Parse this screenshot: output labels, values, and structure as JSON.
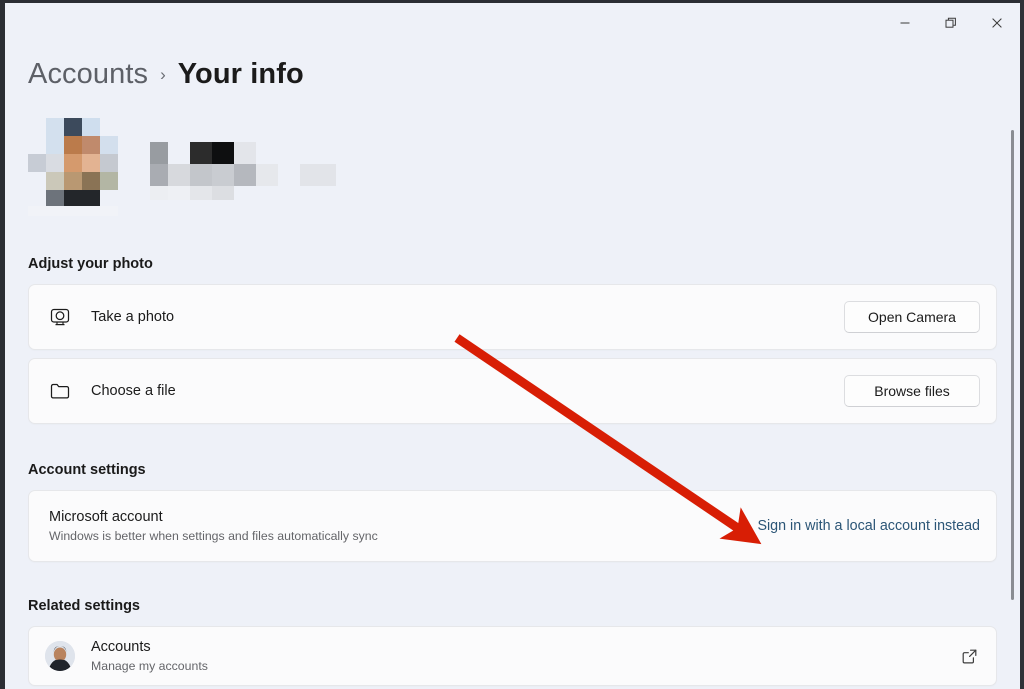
{
  "window": {
    "background_color": "#eef1f8",
    "card_color": "#fbfbfc",
    "accent_link_color": "#2b5576",
    "annotation_color": "#d81e05",
    "controls": {
      "minimize": "─",
      "restore": "❐",
      "close": "✕"
    }
  },
  "header": {
    "breadcrumb_root": "Accounts",
    "breadcrumb_separator": "›",
    "breadcrumb_current": "Your info"
  },
  "profile": {
    "redacted": true,
    "photo_note": "pixelated profile picture",
    "name_note": "pixelated account name",
    "email_note": "pixelated account email"
  },
  "sections": {
    "adjust_photo": {
      "title": "Adjust your photo",
      "rows": [
        {
          "icon": "camera-icon",
          "label": "Take a photo",
          "button": "Open Camera"
        },
        {
          "icon": "folder-icon",
          "label": "Choose a file",
          "button": "Browse files"
        }
      ]
    },
    "account_settings": {
      "title": "Account settings",
      "row": {
        "title": "Microsoft account",
        "subtitle": "Windows is better when settings and files automatically sync",
        "link": "Sign in with a local account instead"
      }
    },
    "related_settings": {
      "title": "Related settings",
      "row": {
        "icon": "avatar",
        "title": "Accounts",
        "subtitle": "Manage my accounts",
        "action_icon": "external-link-icon"
      }
    }
  }
}
